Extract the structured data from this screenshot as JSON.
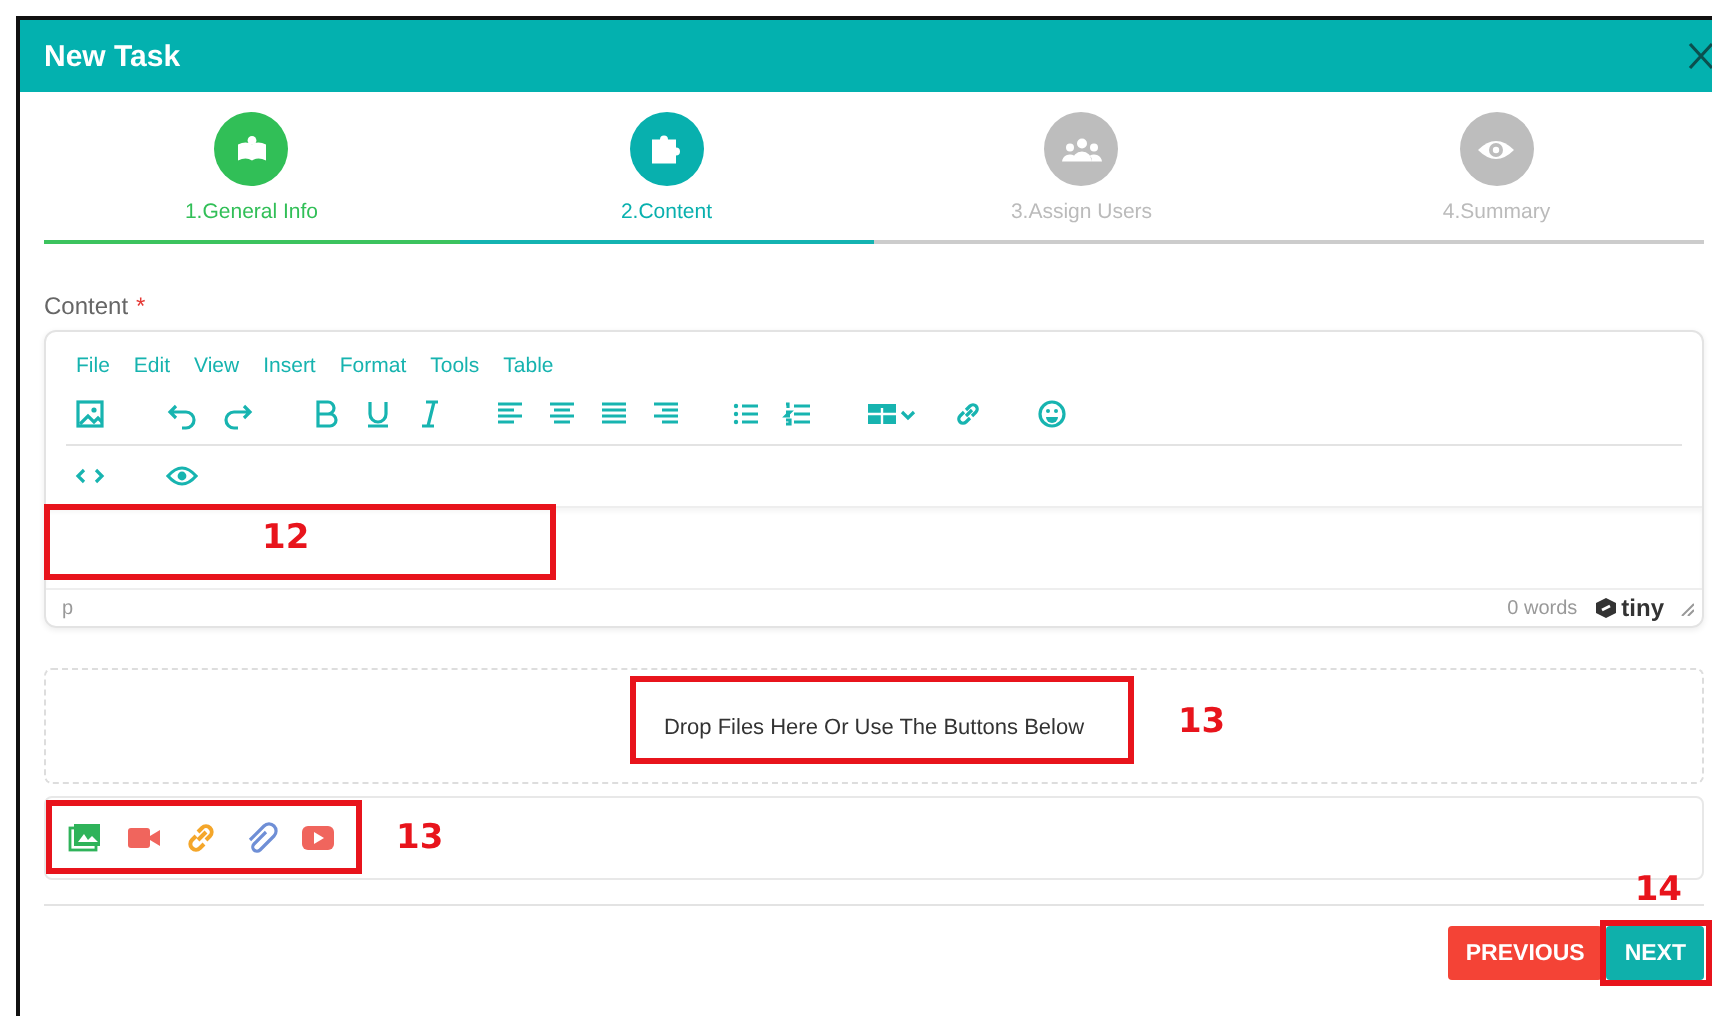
{
  "window": {
    "title": "New Task"
  },
  "steps": [
    {
      "label": "1.General Info",
      "completed": true,
      "selected": false
    },
    {
      "label": "2.Content",
      "completed": false,
      "selected": true
    },
    {
      "label": "3.Assign Users",
      "completed": false,
      "selected": false
    },
    {
      "label": "4.Summary",
      "completed": false,
      "selected": false
    }
  ],
  "content_field": {
    "label": "Content",
    "required_mark": "*"
  },
  "editor": {
    "menu": [
      "File",
      "Edit",
      "View",
      "Insert",
      "Format",
      "Tools",
      "Table"
    ],
    "status_path": "p",
    "word_count": "0 words",
    "brand": "tiny",
    "callout": "12"
  },
  "dropzone": {
    "text": "Drop Files Here Or Use The Buttons Below",
    "callout": "13"
  },
  "attachments": {
    "callout": "13"
  },
  "buttons": [
    {
      "label": "PREVIOUS",
      "kind": "secondary"
    },
    {
      "label": "NEXT",
      "kind": "primary",
      "callout": "14"
    }
  ]
}
